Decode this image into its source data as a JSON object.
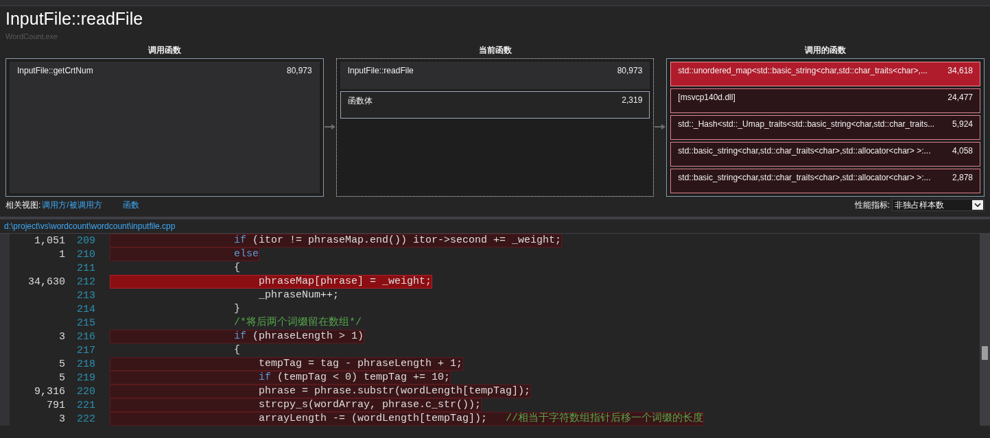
{
  "title": "InputFile::readFile",
  "subtitle": "WordCount.exe",
  "panels": [
    {
      "kind": "callers",
      "heading": "调用函数",
      "items": [
        {
          "kind": "plain",
          "name": "InputFile::getCrtNum",
          "value": "80,973"
        }
      ]
    },
    {
      "kind": "current",
      "heading": "当前函数",
      "items": [
        {
          "kind": "plain",
          "name": "InputFile::readFile",
          "value": "80,973"
        },
        {
          "kind": "body",
          "name": "函数体",
          "value": "2,319"
        }
      ]
    },
    {
      "kind": "callees",
      "heading": "调用的函数",
      "items": [
        {
          "kind": "hot",
          "name": "std::unordered_map<std::basic_string<char,std::char_traits<char>,...",
          "value": "34,618"
        },
        {
          "kind": "warm",
          "name": "[msvcp140d.dll]",
          "value": "24,477"
        },
        {
          "kind": "warm",
          "name": "std::_Hash<std::_Umap_traits<std::basic_string<char,std::char_traits...",
          "value": "5,924"
        },
        {
          "kind": "warm",
          "name": "std::basic_string<char,std::char_traits<char>,std::allocator<char> >:...",
          "value": "4,058"
        },
        {
          "kind": "warm",
          "name": "std::basic_string<char,std::char_traits<char>,std::allocator<char> >:...",
          "value": "2,878"
        }
      ]
    }
  ],
  "related_views": {
    "label": "相关视图:",
    "links": [
      "调用方/被调用方",
      "函数"
    ]
  },
  "metric": {
    "label": "性能指标:",
    "value": "非独占样本数"
  },
  "file_path": "d:\\project\\vs\\wordcount\\wordcount\\inputfile.cpp",
  "code_lines": [
    {
      "count": "1,051",
      "number": "209",
      "kind": "warm",
      "segments": [
        {
          "kind": "keyword",
          "text": "                    if"
        },
        {
          "kind": "plain",
          "text": " (itor != phraseMap.end()) itor->second += _weight;"
        }
      ]
    },
    {
      "count": "1",
      "number": "210",
      "kind": "warm",
      "segments": [
        {
          "kind": "keyword",
          "text": "                    else"
        }
      ]
    },
    {
      "number": "211",
      "kind": "plain",
      "segments": [
        {
          "kind": "plain",
          "text": "                    {"
        }
      ]
    },
    {
      "count": "34,630",
      "number": "212",
      "kind": "hot",
      "segments": [
        {
          "kind": "plain",
          "text": "                        phraseMap[phrase] = _weight;"
        }
      ]
    },
    {
      "number": "213",
      "kind": "plain",
      "segments": [
        {
          "kind": "plain",
          "text": "                        _phraseNum++;"
        }
      ]
    },
    {
      "number": "214",
      "kind": "plain",
      "segments": [
        {
          "kind": "plain",
          "text": "                    }"
        }
      ]
    },
    {
      "number": "215",
      "kind": "plain",
      "segments": [
        {
          "kind": "comment",
          "text": "                    /*将后两个词缀留在数组*/"
        }
      ]
    },
    {
      "count": "3",
      "number": "216",
      "kind": "warm",
      "segments": [
        {
          "kind": "keyword",
          "text": "                    if"
        },
        {
          "kind": "plain",
          "text": " (phraseLength > 1)"
        }
      ]
    },
    {
      "number": "217",
      "kind": "plain",
      "segments": [
        {
          "kind": "plain",
          "text": "                    {"
        }
      ]
    },
    {
      "count": "5",
      "number": "218",
      "kind": "warm",
      "segments": [
        {
          "kind": "plain",
          "text": "                        tempTag = tag - phraseLength + 1;"
        }
      ]
    },
    {
      "count": "5",
      "number": "219",
      "kind": "warm",
      "segments": [
        {
          "kind": "keyword",
          "text": "                        if"
        },
        {
          "kind": "plain",
          "text": " (tempTag < 0) tempTag += 10;"
        }
      ]
    },
    {
      "count": "9,316",
      "number": "220",
      "kind": "warm",
      "segments": [
        {
          "kind": "plain",
          "text": "                        phrase = phrase.substr(wordLength[tempTag]);"
        }
      ]
    },
    {
      "count": "791",
      "number": "221",
      "kind": "warm",
      "segments": [
        {
          "kind": "plain",
          "text": "                        strcpy_s(wordArray, phrase.c_str());"
        }
      ]
    },
    {
      "count": "3",
      "number": "222",
      "kind": "warm",
      "segments": [
        {
          "kind": "plain",
          "text": "                        arrayLength -= (wordLength[tempTag]);   "
        },
        {
          "kind": "comment",
          "text": "//相当于字符数组指针后移一个词缀的长度"
        }
      ]
    }
  ]
}
